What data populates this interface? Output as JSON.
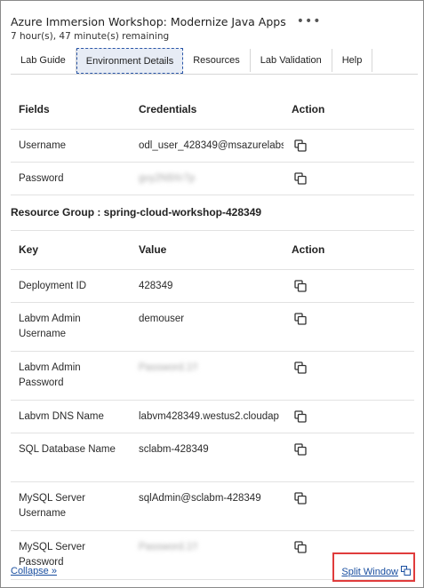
{
  "header": {
    "title": "Azure Immersion Workshop: Modernize Java Apps",
    "more_icon": "more-horizontal-icon",
    "remaining": "7 hour(s), 47 minute(s) remaining"
  },
  "tabs": [
    {
      "label": "Lab Guide",
      "active": false
    },
    {
      "label": "Environment Details",
      "active": true
    },
    {
      "label": "Resources",
      "active": false
    },
    {
      "label": "Lab Validation",
      "active": false
    },
    {
      "label": "Help",
      "active": false
    }
  ],
  "credentials": {
    "headers": {
      "field": "Fields",
      "value": "Credentials",
      "action": "Action"
    },
    "rows": [
      {
        "key": "Username",
        "value": "odl_user_428349@msazurelabs",
        "hidden": false
      },
      {
        "key": "Password",
        "value": "gvy2N9Xr7p",
        "hidden": true
      }
    ]
  },
  "resource_group": {
    "label": "Resource Group : spring-cloud-workshop-428349",
    "headers": {
      "field": "Key",
      "value": "Value",
      "action": "Action"
    },
    "rows": [
      {
        "key": "Deployment ID",
        "value": "428349",
        "hidden": false
      },
      {
        "key": "Labvm Admin Username",
        "value": "demouser",
        "hidden": false
      },
      {
        "key": "Labvm Admin Password",
        "value": "Password.1!!",
        "hidden": true
      },
      {
        "key": "Labvm DNS Name",
        "value": "labvm428349.westus2.cloudap",
        "hidden": false
      },
      {
        "key": "SQL Database Name",
        "value": "sclabm-428349",
        "hidden": false
      },
      {
        "key": "MySQL Server Username",
        "value": "sqlAdmin@sclabm-428349",
        "hidden": false
      },
      {
        "key": "MySQL Server Password",
        "value": "Password.1!!",
        "hidden": true
      }
    ]
  },
  "footer": {
    "collapse_label": "Collapse »",
    "split_label": "Split Window",
    "split_icon": "split-window-icon",
    "highlight_color": "#e03c3c"
  },
  "copy_icon": "copy-icon"
}
